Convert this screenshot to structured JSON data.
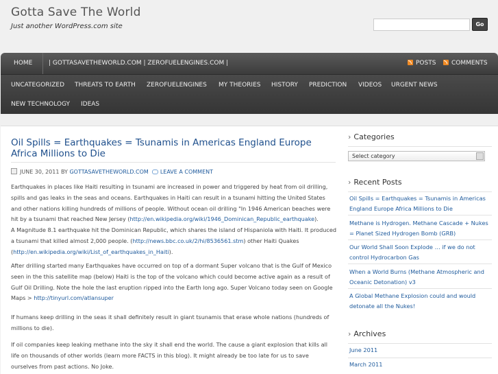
{
  "site": {
    "title": "Gotta Save The World",
    "tagline": "Just another WordPress.com site",
    "search_button": "Go",
    "search_value": ""
  },
  "nav_top": {
    "home": "HOME",
    "domain_link": "| GOTTASAVETHEWORLD.COM | ZEROFUELENGINES.COM |",
    "posts": "POSTS",
    "comments": "COMMENTS"
  },
  "nav_cats": {
    "row1": [
      "UNCATEGORIZED",
      "THREATS TO EARTH",
      "ZEROFUELENGINES",
      "MY THEORIES",
      "HISTORY",
      "PREDICTION",
      "VIDEOS",
      "URGENT NEWS"
    ],
    "row2": [
      "NEW TECHNOLOGY",
      "IDEAS"
    ]
  },
  "post": {
    "title": "Oil Spills = Earthquakes = Tsunamis in Americas England Europe Africa Millions to Die",
    "date": "JUNE 30, 2011 BY",
    "author": "GOTTASAVETHEWORLD.COM",
    "leave_comment": "LEAVE A COMMENT",
    "p1_a": "Earthquakes in places like Haiti resulting in tsunami are increased in power and triggered by heat from oil drilling, spills and gas leaks in the seas and oceans. Earthquakes in Haiti can result in a tsunami hitting the United States and other nations killing hundreds of millions of people. Without ocean oil drilling \"In 1946 American beaches were hit by a tsunami that reached New Jersey (",
    "p1_link1": "http://en.wikipedia.org/wiki/1946_Dominican_Republic_earthquake",
    "p1_b": ").",
    "p1_c": "A Magnitude 8.1 earthquake hit the Dominican Republic, which shares the island of Hispaniola with Haiti. It produced a tsunami that killed almost 2,000 people. (",
    "p1_link2": "http://news.bbc.co.uk/2/hi/8536561.stm",
    "p1_d": ") other Haiti Quakes (",
    "p1_link3": "http://en.wikipedia.org/wiki/List_of_earthquakes_in_Haiti",
    "p1_e": ").",
    "p2_a": "After drilling started many Earthquakes have occurred on top of a dormant Super volcano that is the Gulf of Mexico seen in the this satellite map (below) Haiti is the top of the volcano which could become active again as a result of Gulf Oil Drilling. Note the hole the last eruption ripped into the Earth long ago. Super Volcano today seen on Google Maps > ",
    "p2_link": "http://tinyurl.com/atlansuper",
    "p3": "If humans keep drilling in the seas it shall definitely result in giant tsunamis that erase whole nations (hundreds of millions to die).",
    "p4": "If oil companies keep leaking methane into the sky it shall end the world. The cause a giant explosion that kills all life on thousands of other worlds (learn more FACTS in this blog). It might already be too late for us to save ourselves from past actions. No Joke."
  },
  "sidebar": {
    "categories_title": "Categories",
    "select_value": "Select category",
    "recent_title": "Recent Posts",
    "recent": [
      "Oil Spills = Earthquakes = Tsunamis in Americas England Europe Africa Millions to Die",
      "Methane is Hydrogen. Methane Cascade + Nukes = Planet Sized Hydrogen Bomb (GRB)",
      "Our World Shall Soon Explode … if we do not control Hydrocarbon Gas",
      "When a World Burns (Methane Atmospheric and Oceanic Detonation) v3",
      "A Global Methane Explosion could and would detonate all the Nukes!"
    ],
    "archives_title": "Archives",
    "archives": [
      "June 2011",
      "March 2011"
    ]
  }
}
